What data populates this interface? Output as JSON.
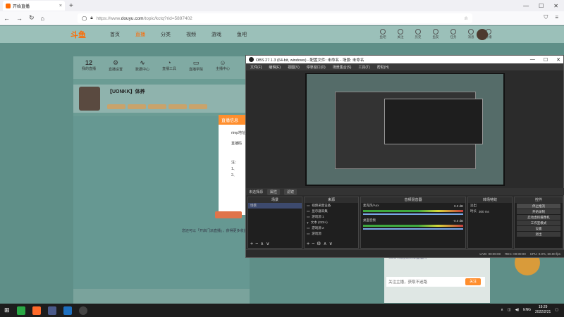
{
  "browser": {
    "tab_title": "开始直播",
    "url_prefix": "https://www.",
    "url_domain": "douyu.com",
    "url_path": "/topic/kctq?rid=5897402"
  },
  "site": {
    "logo": "斗鱼",
    "nav": [
      "首页",
      "直播",
      "分类",
      "视频",
      "游戏",
      "鱼吧"
    ],
    "nav_active_index": 1,
    "header_icons": [
      "鱼吧",
      "关注",
      "历史",
      "鱼友",
      "任务",
      "消息",
      "开播"
    ],
    "category_bar": [
      {
        "value": "12",
        "label": "我的直播"
      },
      {
        "value": "",
        "label": "直播设置"
      },
      {
        "value": "",
        "label": "数据中心"
      },
      {
        "value": "",
        "label": "直播工具"
      },
      {
        "value": "",
        "label": "直播学院"
      },
      {
        "value": "",
        "label": "主播中心"
      }
    ],
    "streamer_name": "【UONKK】体养",
    "dialog_title": "直播信息",
    "dialog_lines": [
      "rtmp地址",
      "直播码",
      "注：",
      "1、",
      "2、"
    ],
    "hint_text": "您还可以「开启门派直播」，获得更多收益",
    "follow_placeholder": "关注主播，获取不迷路",
    "follow_button": "关注",
    "chat_line": "Cokin 欢迎来到本直播间"
  },
  "obs": {
    "title": "OBS 27.1.3 (64-bit, windows) - 配置文件: 未命名 - 场景: 未命名",
    "menu": [
      "文件(F)",
      "编辑(E)",
      "视图(V)",
      "停靠窗口(D)",
      "场景集合(S)",
      "工具(T)",
      "帮助(H)"
    ],
    "below_preview": [
      "未选择源",
      "属性",
      "滤镜"
    ],
    "scenes_header": "场景",
    "scenes": [
      "场景"
    ],
    "sources_header": "来源",
    "sources": [
      "视频采集设备",
      "显示器采集",
      "游戏源 1",
      "文本 (GDI+)",
      "游戏源 2",
      "游戏源"
    ],
    "mixer_header": "音频混音器",
    "mixer": [
      {
        "name": "麦克风/Aux",
        "db": "0.0 dB"
      },
      {
        "name": "桌面音频",
        "db": "-0.0 dB"
      }
    ],
    "transitions_header": "转场特效",
    "transition_type": "淡出",
    "duration_label": "时长",
    "duration_value": "300 ms",
    "controls_header": "控件",
    "controls": [
      "停止推流",
      "开始录制",
      "启动虚拟摄像机",
      "工作室模式",
      "设置",
      "退出"
    ],
    "status": [
      "LIVE: 00:00:00",
      "REC: 00:00:00",
      "CPU: 0.0%, 60.00 fps"
    ]
  },
  "taskbar": {
    "lang": "ENG",
    "time": "19:29",
    "date": "2022/2/21"
  }
}
